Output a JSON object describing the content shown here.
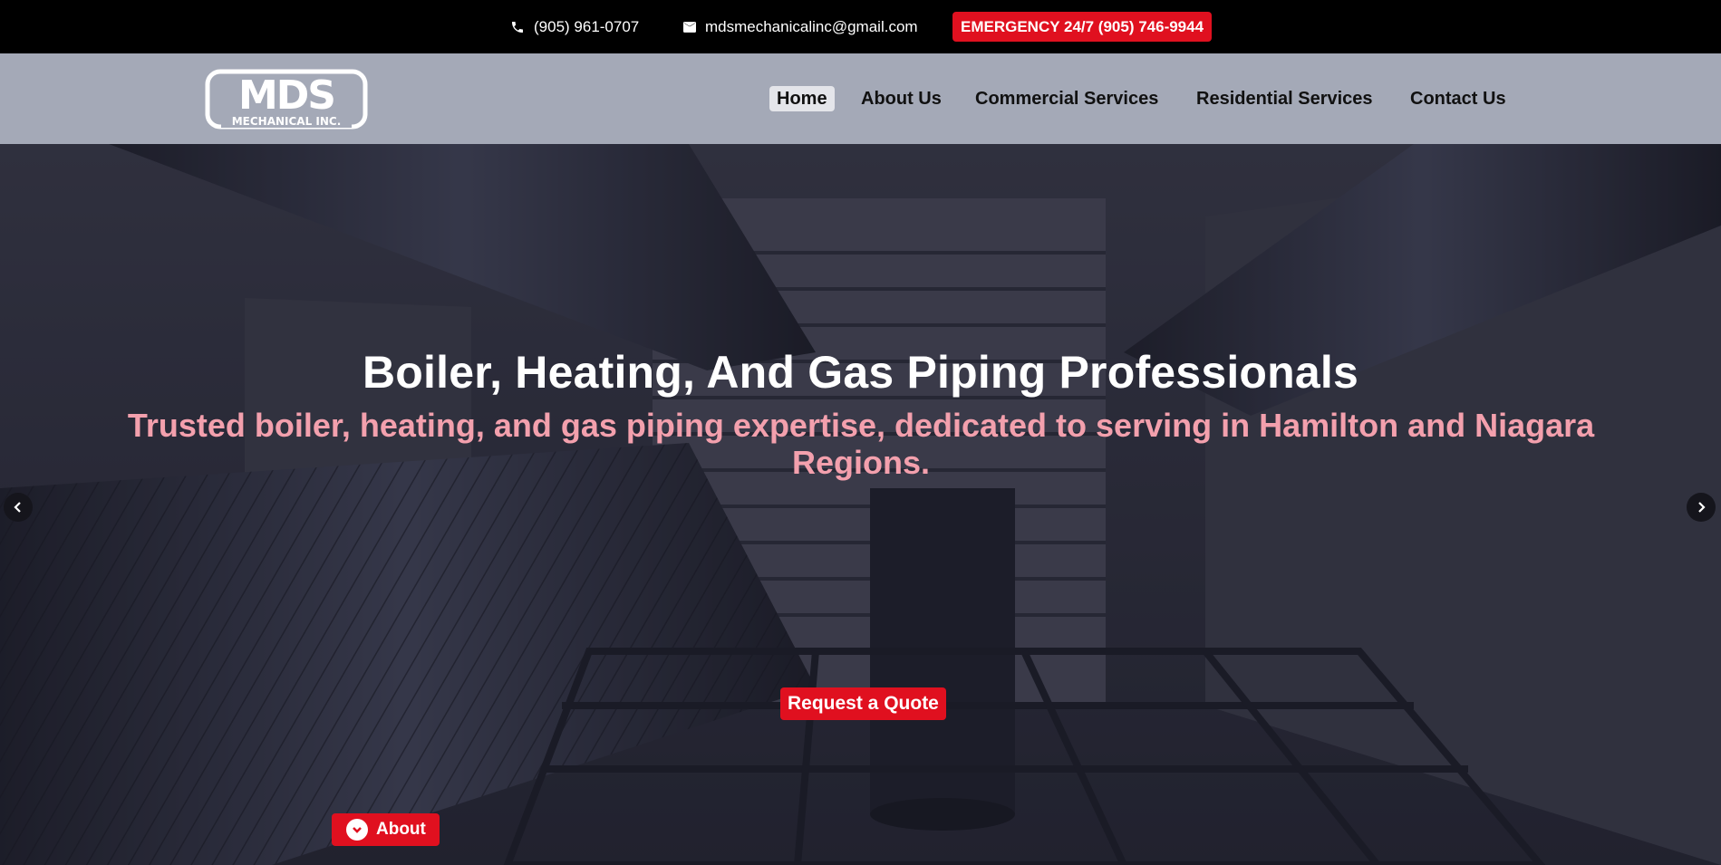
{
  "topbar": {
    "phone": "(905) 961-0707",
    "email": "mdsmechanicalinc@gmail.com",
    "emergency": "EMERGENCY 24/7 (905) 746-9944",
    "phone_icon": "phone-icon",
    "email_icon": "envelope-icon"
  },
  "logo": {
    "main": "MDS",
    "sub": "MECHANICAL INC."
  },
  "nav": {
    "items": [
      {
        "label": "Home",
        "active": true
      },
      {
        "label": "About Us"
      },
      {
        "label": "Commercial Services"
      },
      {
        "label": "Residential Services"
      },
      {
        "label": "Contact Us"
      }
    ]
  },
  "hero": {
    "title": "Boiler, Heating, And Gas Piping Professionals",
    "subtitle": "Trusted boiler, heating, and gas piping expertise, dedicated to serving in Hamilton and Niagara Regions.",
    "cta": "Request a Quote",
    "about_button": "About",
    "prev_icon": "chevron-left-icon",
    "next_icon": "chevron-right-icon"
  },
  "colors": {
    "accent": "#e0101f",
    "topbar": "#000000",
    "nav": "#a4a9b7",
    "subtitle": "#f3a0ad"
  }
}
